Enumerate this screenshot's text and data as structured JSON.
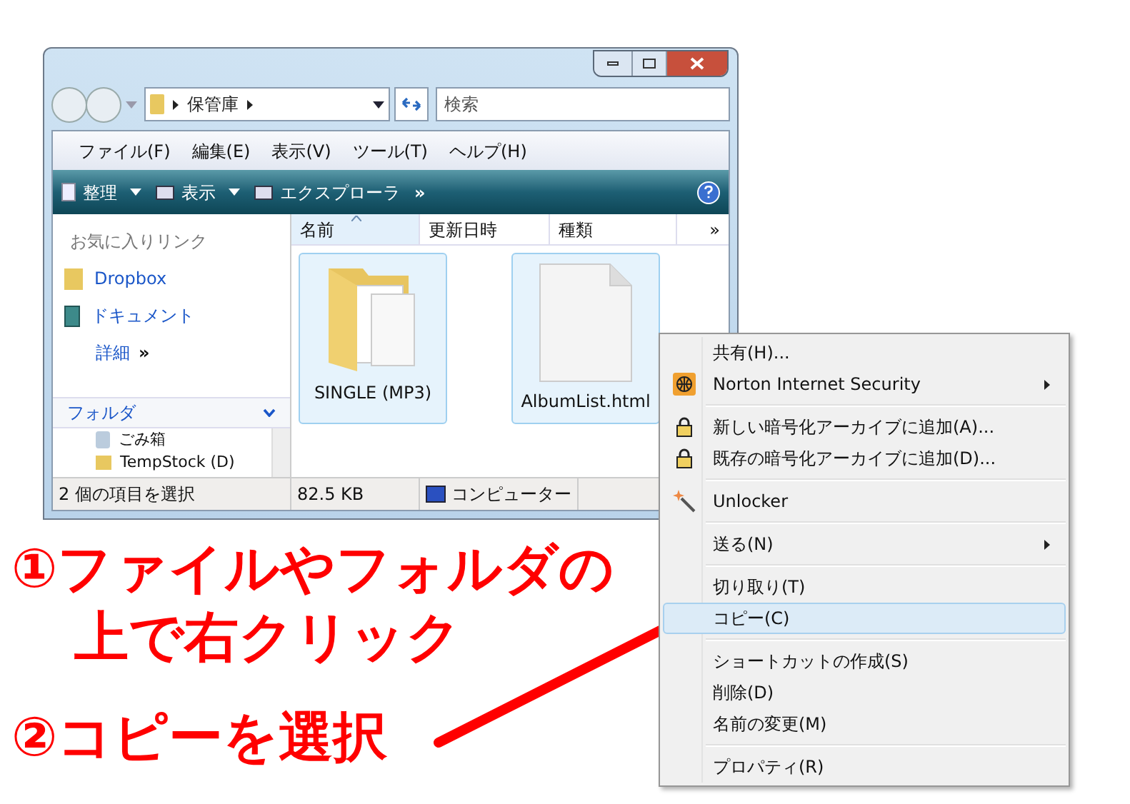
{
  "address_bar": {
    "path": [
      "保管庫"
    ]
  },
  "search": {
    "placeholder": "検索"
  },
  "menu_bar": [
    "ファイル(F)",
    "編集(E)",
    "表示(V)",
    "ツール(T)",
    "ヘルプ(H)"
  ],
  "toolbar": {
    "items": [
      {
        "label": "整理",
        "has_dropdown": true
      },
      {
        "label": "表示",
        "has_dropdown": true
      },
      {
        "label": "エクスプローラ",
        "has_dropdown": false
      }
    ],
    "overflow": "»"
  },
  "nav_pane": {
    "favorites_title": "お気に入りリンク",
    "links": [
      "Dropbox",
      "ドキュメント"
    ],
    "more_label": "詳細",
    "more_chevron": "»",
    "folders_title": "フォルダ",
    "tree": [
      "ごみ箱",
      "TempStock (D)"
    ]
  },
  "columns": [
    {
      "label": "名前",
      "sorted": true
    },
    {
      "label": "更新日時",
      "sorted": false
    },
    {
      "label": "種類",
      "sorted": false
    }
  ],
  "columns_overflow": "»",
  "files": [
    {
      "name": "SINGLE (MP3)",
      "kind": "folder",
      "selected": true
    },
    {
      "name": "AlbumList.html",
      "kind": "file",
      "selected": true
    }
  ],
  "status_bar": [
    "2 個の項目を選択",
    "82.5 KB",
    "コンピューター"
  ],
  "context_menu": [
    {
      "kind": "item",
      "label": "共有(H)...",
      "has_submenu": false,
      "selected": false
    },
    {
      "kind": "item",
      "label": "Norton Internet Security",
      "has_submenu": true,
      "selected": false
    },
    {
      "kind": "separator"
    },
    {
      "kind": "item",
      "label": "新しい暗号化アーカイブに追加(A)...",
      "has_submenu": false,
      "selected": false
    },
    {
      "kind": "item",
      "label": "既存の暗号化アーカイブに追加(D)...",
      "has_submenu": false,
      "selected": false
    },
    {
      "kind": "separator"
    },
    {
      "kind": "item",
      "label": "Unlocker",
      "has_submenu": false,
      "selected": false
    },
    {
      "kind": "separator"
    },
    {
      "kind": "item",
      "label": "送る(N)",
      "has_submenu": true,
      "selected": false
    },
    {
      "kind": "separator"
    },
    {
      "kind": "item",
      "label": "切り取り(T)",
      "has_submenu": false,
      "selected": false
    },
    {
      "kind": "item",
      "label": "コピー(C)",
      "has_submenu": false,
      "selected": true
    },
    {
      "kind": "separator"
    },
    {
      "kind": "item",
      "label": "ショートカットの作成(S)",
      "has_submenu": false,
      "selected": false
    },
    {
      "kind": "item",
      "label": "削除(D)",
      "has_submenu": false,
      "selected": false
    },
    {
      "kind": "item",
      "label": "名前の変更(M)",
      "has_submenu": false,
      "selected": false
    },
    {
      "kind": "separator"
    },
    {
      "kind": "item",
      "label": "プロパティ(R)",
      "has_submenu": false,
      "selected": false
    }
  ],
  "annotations": [
    "①ファイルやフォルダの",
    "上で右クリック",
    "②コピーを選択"
  ]
}
